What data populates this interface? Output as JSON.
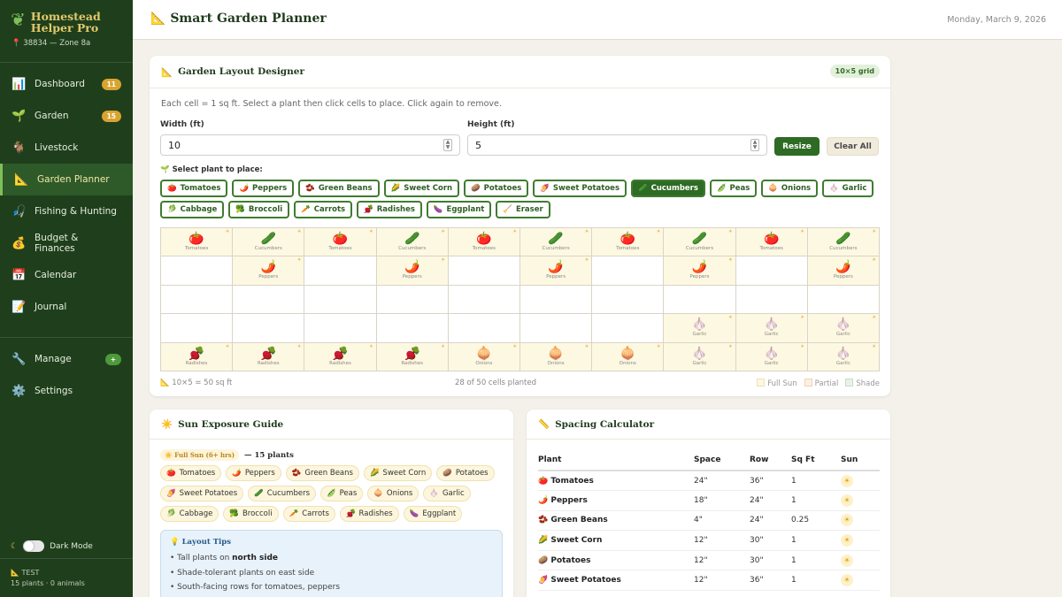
{
  "sidebar": {
    "brand": "Homestead Helper Pro",
    "location": "38834 — Zone 8a",
    "items": [
      {
        "label": "Dashboard",
        "icon": "chart-icon",
        "glyph": "📊",
        "badge": "11"
      },
      {
        "label": "Garden",
        "icon": "seedling-icon",
        "glyph": "🌱",
        "badge": "15"
      },
      {
        "label": "Livestock",
        "icon": "goat-icon",
        "glyph": "🐐",
        "badge": ""
      },
      {
        "label": "Garden Planner",
        "icon": "ruler-icon",
        "glyph": "📐",
        "badge": ""
      },
      {
        "label": "Fishing & Hunting",
        "icon": "fishing-icon",
        "glyph": "🎣",
        "badge": ""
      },
      {
        "label": "Budget & Finances",
        "icon": "money-icon",
        "glyph": "💰",
        "badge": ""
      },
      {
        "label": "Calendar",
        "icon": "calendar-icon",
        "glyph": "📅",
        "badge": ""
      },
      {
        "label": "Journal",
        "icon": "journal-icon",
        "glyph": "📝",
        "badge": ""
      },
      {
        "label": "Manage",
        "icon": "wrench-icon",
        "glyph": "🔧",
        "badge": "+"
      },
      {
        "label": "Settings",
        "icon": "gear-icon",
        "glyph": "⚙️",
        "badge": ""
      }
    ],
    "dark_mode": "Dark Mode",
    "test_label": "TEST",
    "test_stats": "15 plants · 0 animals"
  },
  "header": {
    "title": "Smart Garden Planner",
    "date": "Monday, March 9, 2026"
  },
  "designer": {
    "title": "Garden Layout Designer",
    "grid_pill": "10×5 grid",
    "description": "Each cell = 1 sq ft. Select a plant then click cells to place. Click again to remove.",
    "width_label": "Width (ft)",
    "width_value": "10",
    "height_label": "Height (ft)",
    "height_value": "5",
    "resize": "Resize",
    "clear": "Clear All",
    "select_label": "Select plant to place:",
    "plants": [
      {
        "e": "🍅",
        "n": "Tomatoes"
      },
      {
        "e": "🌶️",
        "n": "Peppers"
      },
      {
        "e": "🫘",
        "n": "Green Beans"
      },
      {
        "e": "🌽",
        "n": "Sweet Corn"
      },
      {
        "e": "🥔",
        "n": "Potatoes"
      },
      {
        "e": "🍠",
        "n": "Sweet Potatoes"
      },
      {
        "e": "🥒",
        "n": "Cucumbers",
        "sel": true
      },
      {
        "e": "🫛",
        "n": "Peas"
      },
      {
        "e": "🧅",
        "n": "Onions"
      },
      {
        "e": "🧄",
        "n": "Garlic"
      },
      {
        "e": "🥬",
        "n": "Cabbage"
      },
      {
        "e": "🥦",
        "n": "Broccoli"
      },
      {
        "e": "🥕",
        "n": "Carrots"
      },
      {
        "e": "🫜",
        "n": "Radishes"
      },
      {
        "e": "🍆",
        "n": "Eggplant"
      },
      {
        "e": "🧹",
        "n": "Eraser"
      }
    ],
    "grid": [
      [
        "Tomatoes",
        "Cucumbers",
        "Tomatoes",
        "Cucumbers",
        "Tomatoes",
        "Cucumbers",
        "Tomatoes",
        "Cucumbers",
        "Tomatoes",
        "Cucumbers"
      ],
      [
        "",
        "Peppers",
        "",
        "Peppers",
        "",
        "Peppers",
        "",
        "Peppers",
        "",
        "Peppers"
      ],
      [
        "",
        "",
        "",
        "",
        "",
        "",
        "",
        "",
        "",
        ""
      ],
      [
        "",
        "",
        "",
        "",
        "",
        "",
        "",
        "Garlic",
        "Garlic",
        "Garlic"
      ],
      [
        "Radishes",
        "Radishes",
        "Radishes",
        "Radishes",
        "Onions",
        "Onions",
        "Onions",
        "Garlic",
        "Garlic",
        "Garlic"
      ]
    ],
    "emoji": {
      "Tomatoes": "🍅",
      "Cucumbers": "🥒",
      "Peppers": "🌶️",
      "Garlic": "🧄",
      "Radishes": "🫜",
      "Onions": "🧅"
    },
    "area": "10×5 = 50 sq ft",
    "planted": "28 of 50 cells planted",
    "legend": [
      "Full Sun",
      "Partial",
      "Shade"
    ]
  },
  "sun_guide": {
    "title": "Sun Exposure Guide",
    "full_sun": "☀️ Full Sun (6+ hrs)",
    "count": "— 15 plants",
    "plants": [
      {
        "e": "🍅",
        "n": "Tomatoes"
      },
      {
        "e": "🌶️",
        "n": "Peppers"
      },
      {
        "e": "🫘",
        "n": "Green Beans"
      },
      {
        "e": "🌽",
        "n": "Sweet Corn"
      },
      {
        "e": "🥔",
        "n": "Potatoes"
      },
      {
        "e": "🍠",
        "n": "Sweet Potatoes"
      },
      {
        "e": "🥒",
        "n": "Cucumbers"
      },
      {
        "e": "🫛",
        "n": "Peas"
      },
      {
        "e": "🧅",
        "n": "Onions"
      },
      {
        "e": "🧄",
        "n": "Garlic"
      },
      {
        "e": "🥬",
        "n": "Cabbage"
      },
      {
        "e": "🥦",
        "n": "Broccoli"
      },
      {
        "e": "🥕",
        "n": "Carrots"
      },
      {
        "e": "🫜",
        "n": "Radishes"
      },
      {
        "e": "🍆",
        "n": "Eggplant"
      }
    ],
    "tips_title": "Layout Tips",
    "tips": [
      {
        "pre": "Tall plants on ",
        "b": "north side"
      },
      {
        "pre": "Shade-tolerant plants on east side",
        "b": ""
      },
      {
        "pre": "South-facing rows for tomatoes, peppers",
        "b": ""
      }
    ]
  },
  "spacing": {
    "title": "Spacing Calculator",
    "headers": [
      "Plant",
      "Space",
      "Row",
      "Sq Ft",
      "Sun"
    ],
    "rows": [
      {
        "e": "🍅",
        "plant": "Tomatoes",
        "space": "24\"",
        "row": "36\"",
        "sqft": "1"
      },
      {
        "e": "🌶️",
        "plant": "Peppers",
        "space": "18\"",
        "row": "24\"",
        "sqft": "1"
      },
      {
        "e": "🫘",
        "plant": "Green Beans",
        "space": "4\"",
        "row": "24\"",
        "sqft": "0.25"
      },
      {
        "e": "🌽",
        "plant": "Sweet Corn",
        "space": "12\"",
        "row": "30\"",
        "sqft": "1"
      },
      {
        "e": "🥔",
        "plant": "Potatoes",
        "space": "12\"",
        "row": "30\"",
        "sqft": "1"
      },
      {
        "e": "🍠",
        "plant": "Sweet Potatoes",
        "space": "12\"",
        "row": "36\"",
        "sqft": "1"
      }
    ]
  }
}
